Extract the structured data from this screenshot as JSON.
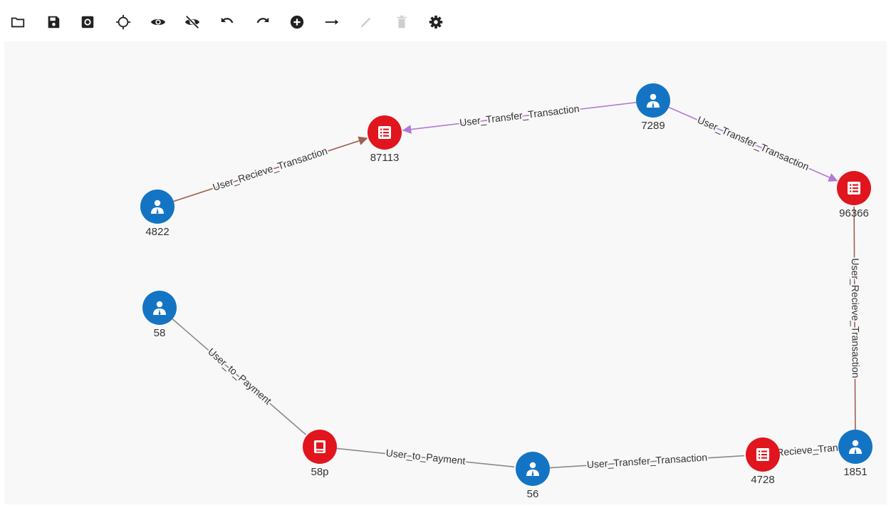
{
  "toolbar": {
    "buttons": [
      {
        "icon": "folder-icon",
        "enabled": true
      },
      {
        "icon": "save-icon",
        "enabled": true
      },
      {
        "icon": "camera-icon",
        "enabled": true
      },
      {
        "icon": "crosshair-icon",
        "enabled": true
      },
      {
        "icon": "eye-icon",
        "enabled": true
      },
      {
        "icon": "eye-off-icon",
        "enabled": true
      },
      {
        "icon": "undo-icon",
        "enabled": true
      },
      {
        "icon": "redo-icon",
        "enabled": true
      },
      {
        "icon": "add-circle-icon",
        "enabled": true
      },
      {
        "icon": "arrow-right-icon",
        "enabled": true
      },
      {
        "icon": "edit-icon",
        "enabled": false
      },
      {
        "icon": "delete-icon",
        "enabled": false
      },
      {
        "icon": "settings-icon",
        "enabled": true
      }
    ]
  },
  "colors": {
    "user_node": "#1474c4",
    "transaction_node": "#e0151d",
    "payment_node": "#e0151d",
    "edge_default": "#8a8a8a",
    "edge_transfer": "#b279d6",
    "edge_receive": "#a0604f"
  },
  "graph": {
    "nodes": [
      {
        "id": "7289",
        "label": "7289",
        "type": "user"
      },
      {
        "id": "87113",
        "label": "87113",
        "type": "transaction"
      },
      {
        "id": "4822",
        "label": "4822",
        "type": "user"
      },
      {
        "id": "96366",
        "label": "96366",
        "type": "transaction"
      },
      {
        "id": "58",
        "label": "58",
        "type": "user"
      },
      {
        "id": "58p",
        "label": "58p",
        "type": "payment"
      },
      {
        "id": "56",
        "label": "56",
        "type": "user"
      },
      {
        "id": "4728",
        "label": "4728",
        "type": "transaction"
      },
      {
        "id": "1851",
        "label": "1851",
        "type": "user"
      }
    ],
    "edges": [
      {
        "id": "e1",
        "from": "7289",
        "to": "87113",
        "label": "User_Transfer_Transaction",
        "kind": "transfer",
        "arrow": true
      },
      {
        "id": "e2",
        "from": "7289",
        "to": "96366",
        "label": "User_Transfer_Transaction",
        "kind": "transfer",
        "arrow": true
      },
      {
        "id": "e3",
        "from": "4822",
        "to": "87113",
        "label": "User_Recieve_Transaction",
        "kind": "receive",
        "arrow": true
      },
      {
        "id": "e4",
        "from": "1851",
        "to": "96366",
        "label": "User_Recieve_Transaction",
        "kind": "receive",
        "arrow": false
      },
      {
        "id": "e5",
        "from": "58",
        "to": "58p",
        "label": "User_to_Payment",
        "kind": "default",
        "arrow": false
      },
      {
        "id": "e6",
        "from": "58p",
        "to": "56",
        "label": "User_to_Payment",
        "kind": "default",
        "arrow": false
      },
      {
        "id": "e7",
        "from": "56",
        "to": "4728",
        "label": "User_Transfer_Transaction",
        "kind": "default",
        "arrow": false
      },
      {
        "id": "e8",
        "from": "1851",
        "to": "4728",
        "label": "User_Recieve_Transaction",
        "kind": "default",
        "arrow": false
      }
    ]
  }
}
